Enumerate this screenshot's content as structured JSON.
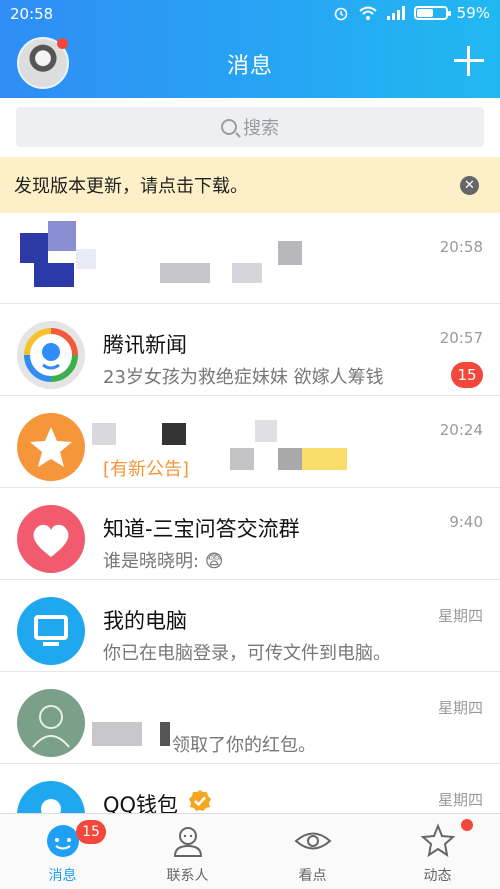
{
  "statusbar": {
    "time": "20:58",
    "battery_pct": "59%",
    "battery_level": 0.59
  },
  "header": {
    "title": "消息"
  },
  "search": {
    "placeholder": "搜索"
  },
  "notice": {
    "text": "发现版本更新，请点击下载。"
  },
  "conversations": [
    {
      "name": "",
      "message": "",
      "time": "20:58"
    },
    {
      "name": "腾讯新闻",
      "message": "23岁女孩为救绝症妹妹 欲嫁人筹钱",
      "time": "20:57",
      "badge": "15"
    },
    {
      "name": "",
      "message": "[有新公告]",
      "time": "20:24"
    },
    {
      "name": "知道-三宝问答交流群",
      "message": "谁是晓晓明: 😨",
      "time": "9:40"
    },
    {
      "name": "我的电脑",
      "message": "你已在电脑登录，可传文件到电脑。",
      "time": "星期四"
    },
    {
      "name": "",
      "message": "领取了你的红包。",
      "time": "星期四"
    },
    {
      "name": "QQ钱包",
      "message": "",
      "time": "星期四"
    }
  ],
  "tabs": [
    {
      "label": "消息",
      "badge": "15"
    },
    {
      "label": "联系人"
    },
    {
      "label": "看点"
    },
    {
      "label": "动态"
    }
  ],
  "colors": {
    "accent": "#1fa0f5",
    "badge": "#f3473b",
    "notice_bg": "#fdf0c8"
  }
}
